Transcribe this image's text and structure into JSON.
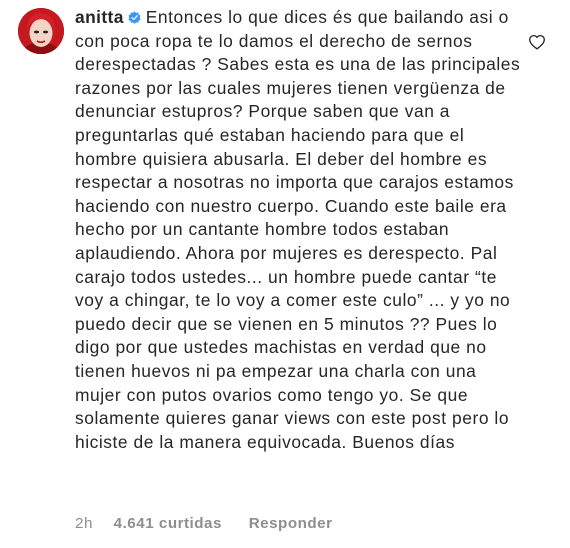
{
  "comment": {
    "username": "anitta",
    "verified": true,
    "text": "Entonces lo que dices és que bailando asi o con poca ropa te lo damos el derecho de sernos derespectadas ? Sabes esta es una de las principales razones por las cuales mujeres tienen vergüenza de denunciar estupros? Porque saben que van a preguntarlas qué estaban haciendo para que el hombre quisiera abusarla. El deber del hombre es respectar a nosotras no importa que carajos estamos haciendo con nuestro cuerpo. Cuando este baile era hecho por un cantante hombre todos estaban aplaudiendo. Ahora por mujeres es derespecto. Pal carajo todos ustedes... un hombre puede cantar “te voy a chingar, te lo voy a comer este culo” ... y yo no puedo decir que se vienen en 5 minutos ?? Pues lo digo por que ustedes machistas en verdad que no tienen huevos ni pa empezar una charla con una mujer con putos ovarios como tengo yo. Se que solamente quieres ganar views con este post pero lo hiciste de la manera equivocada. Buenos días",
    "time": "2h",
    "likes": "4.641 curtidas",
    "reply_label": "Responder"
  },
  "icons": {
    "avatar": "avatar-image",
    "verified": "verified-badge-icon",
    "like": "heart-outline-icon"
  },
  "colors": {
    "text": "#262626",
    "meta": "#8e8e8e",
    "verified_badge": "#3897f0"
  }
}
